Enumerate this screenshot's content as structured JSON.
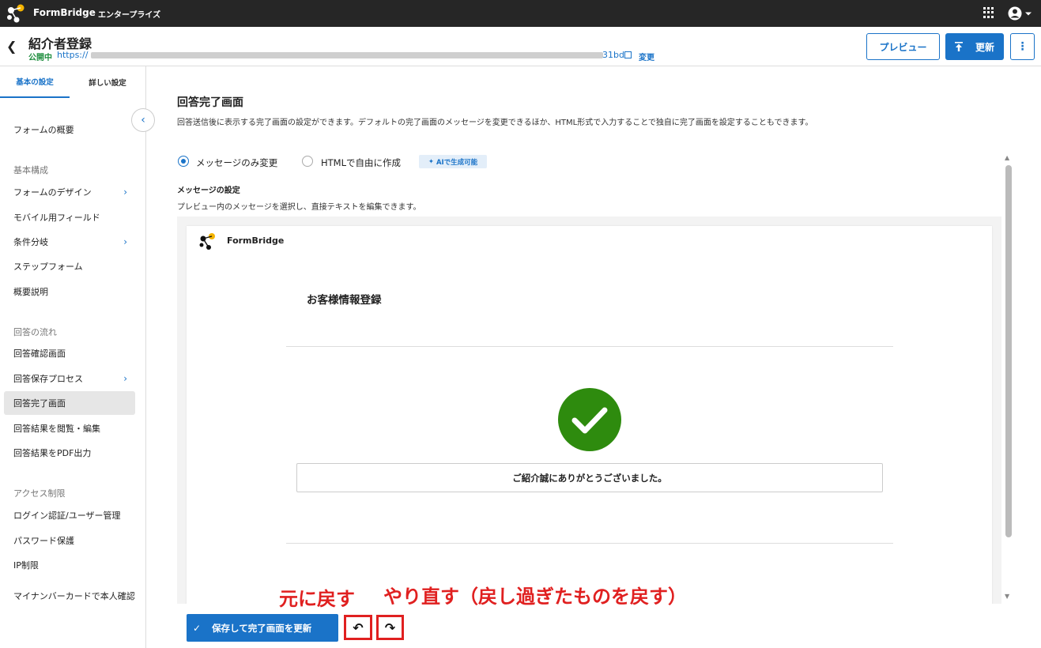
{
  "topbar": {
    "brand": "FormBridge",
    "edition": "エンタープライズ"
  },
  "header": {
    "title": "紹介者登録",
    "status": "公開中",
    "url_prefix": "https://",
    "url_suffix": "31bd",
    "change_link": "変更",
    "preview_label": "プレビュー",
    "update_label": "更新",
    "more_label": "⋮"
  },
  "sidebar": {
    "tabs": [
      {
        "label": "基本の設定"
      },
      {
        "label": "詳しい設定"
      }
    ],
    "overview": "フォームの概要",
    "sections": [
      {
        "title": "基本構成",
        "items": [
          {
            "label": "フォームのデザイン",
            "has_arrow": true
          },
          {
            "label": "モバイル用フィールド"
          },
          {
            "label": "条件分岐",
            "has_arrow": true
          },
          {
            "label": "ステップフォーム"
          },
          {
            "label": "概要説明"
          }
        ]
      },
      {
        "title": "回答の流れ",
        "items": [
          {
            "label": "回答確認画面"
          },
          {
            "label": "回答保存プロセス",
            "has_arrow": true
          },
          {
            "label": "回答完了画面",
            "selected": true
          },
          {
            "label": "回答結果を閲覧・編集"
          },
          {
            "label": "回答結果をPDF出力"
          }
        ]
      },
      {
        "title": "アクセス制限",
        "items": [
          {
            "label": "ログイン認証/ユーザー管理"
          },
          {
            "label": "パスワード保護"
          },
          {
            "label": "IP制限"
          },
          {
            "label": "マイナンバーカードで本人確認"
          }
        ]
      }
    ]
  },
  "main": {
    "title": "回答完了画面",
    "description": "回答送信後に表示する完了画面の設定ができます。デフォルトの完了画面のメッセージを変更できるほか、HTML形式で入力することで独自に完了画面を設定することもできます。",
    "options": [
      {
        "label": "メッセージのみ変更",
        "selected": true
      },
      {
        "label": "HTMLで自由に作成",
        "selected": false
      }
    ],
    "ai_badge": "AIで生成可能",
    "message_title": "メッセージの設定",
    "message_desc": "プレビュー内のメッセージを選択し、直接テキストを編集できます。",
    "preview": {
      "brand": "FormBridge",
      "form_title": "お客様情報登録",
      "message": "ご紹介誠にありがとうございました。"
    },
    "save_label": "保存して完了画面を更新",
    "undo_symbol": "↶",
    "redo_symbol": "↷"
  },
  "annotations": {
    "undo": "元に戻す",
    "redo": "やり直す（戻し過ぎたものを戻す）"
  },
  "colors": {
    "accent": "#1a73c8",
    "success": "#2e8b0e",
    "annotation": "#e02020",
    "topbar": "#262626"
  }
}
